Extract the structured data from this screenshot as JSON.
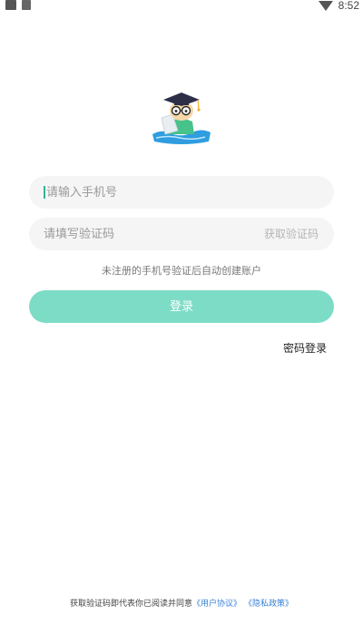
{
  "status_bar": {
    "time": "8:52",
    "left_icons": [
      "app-notification-icon",
      "app-notification-icon"
    ],
    "right_icons": [
      "wifi-icon"
    ]
  },
  "logo": {
    "icon": "graduate-mascot-icon",
    "hat_color": "#2c2f48",
    "shirt_color": "#46c28a",
    "water_color": "#2f9de0"
  },
  "form": {
    "phone_placeholder": "请输入手机号",
    "code_placeholder": "请填写验证码",
    "get_code_label": "获取验证码",
    "hint": "未注册的手机号验证后自动创建账户",
    "login_label": "登录",
    "password_login_label": "密码登录"
  },
  "colors": {
    "accent": "#7ddcc6",
    "field_bg": "#f5f5f5",
    "link": "#3a82d6"
  },
  "agreement": {
    "prefix": "获取验证码即代表你已阅读并同意",
    "user_agreement": "《用户协议》",
    "privacy_policy": "《隐私政策》"
  }
}
